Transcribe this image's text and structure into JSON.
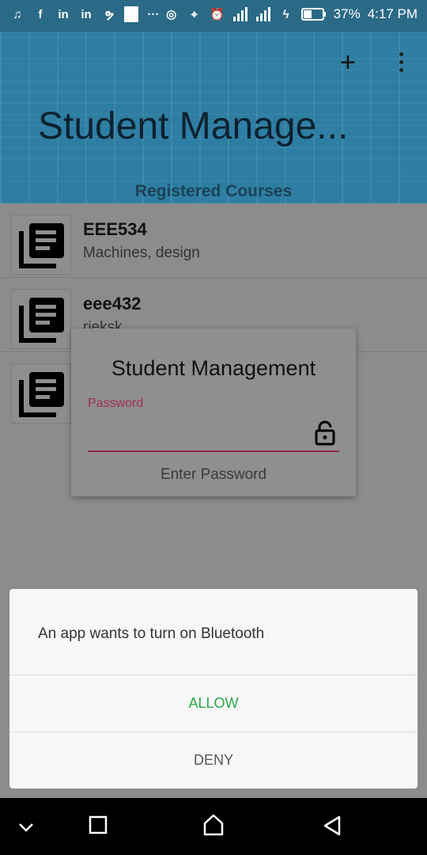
{
  "status_bar": {
    "battery": "37%",
    "time": "4:17 PM",
    "left_icons": [
      "music-icon",
      "facebook-icon",
      "linkedin-icon",
      "linkedin-icon",
      "swirl-icon",
      "white-square-icon",
      "more-dots-icon"
    ],
    "right_icons": [
      "hotspot-icon",
      "location-icon",
      "alarm-icon",
      "signal-icon",
      "signal-4g-icon",
      "charging-icon",
      "battery-icon"
    ]
  },
  "app_bar": {
    "title": "Student Manage...",
    "subtitle": "Registered Courses",
    "add_icon": "plus-icon",
    "menu_icon": "overflow-menu-icon",
    "color": "#2e7ea3"
  },
  "courses": [
    {
      "code": "EEE534",
      "description": "Machines, design"
    },
    {
      "code": "eee432",
      "description": "rieksk"
    },
    {
      "code": "",
      "description": ""
    }
  ],
  "password_dialog": {
    "title": "Student Management",
    "label": "Password",
    "value": "",
    "hint": "Enter Password",
    "accent": "#a0304f"
  },
  "bluetooth_dialog": {
    "message": "An app wants to turn on Bluetooth",
    "allow": "ALLOW",
    "deny": "DENY",
    "allow_color": "#2aa84a"
  },
  "nav_bar": {
    "icons": [
      "chevron-down-icon",
      "recents-icon",
      "home-icon",
      "back-icon"
    ]
  }
}
